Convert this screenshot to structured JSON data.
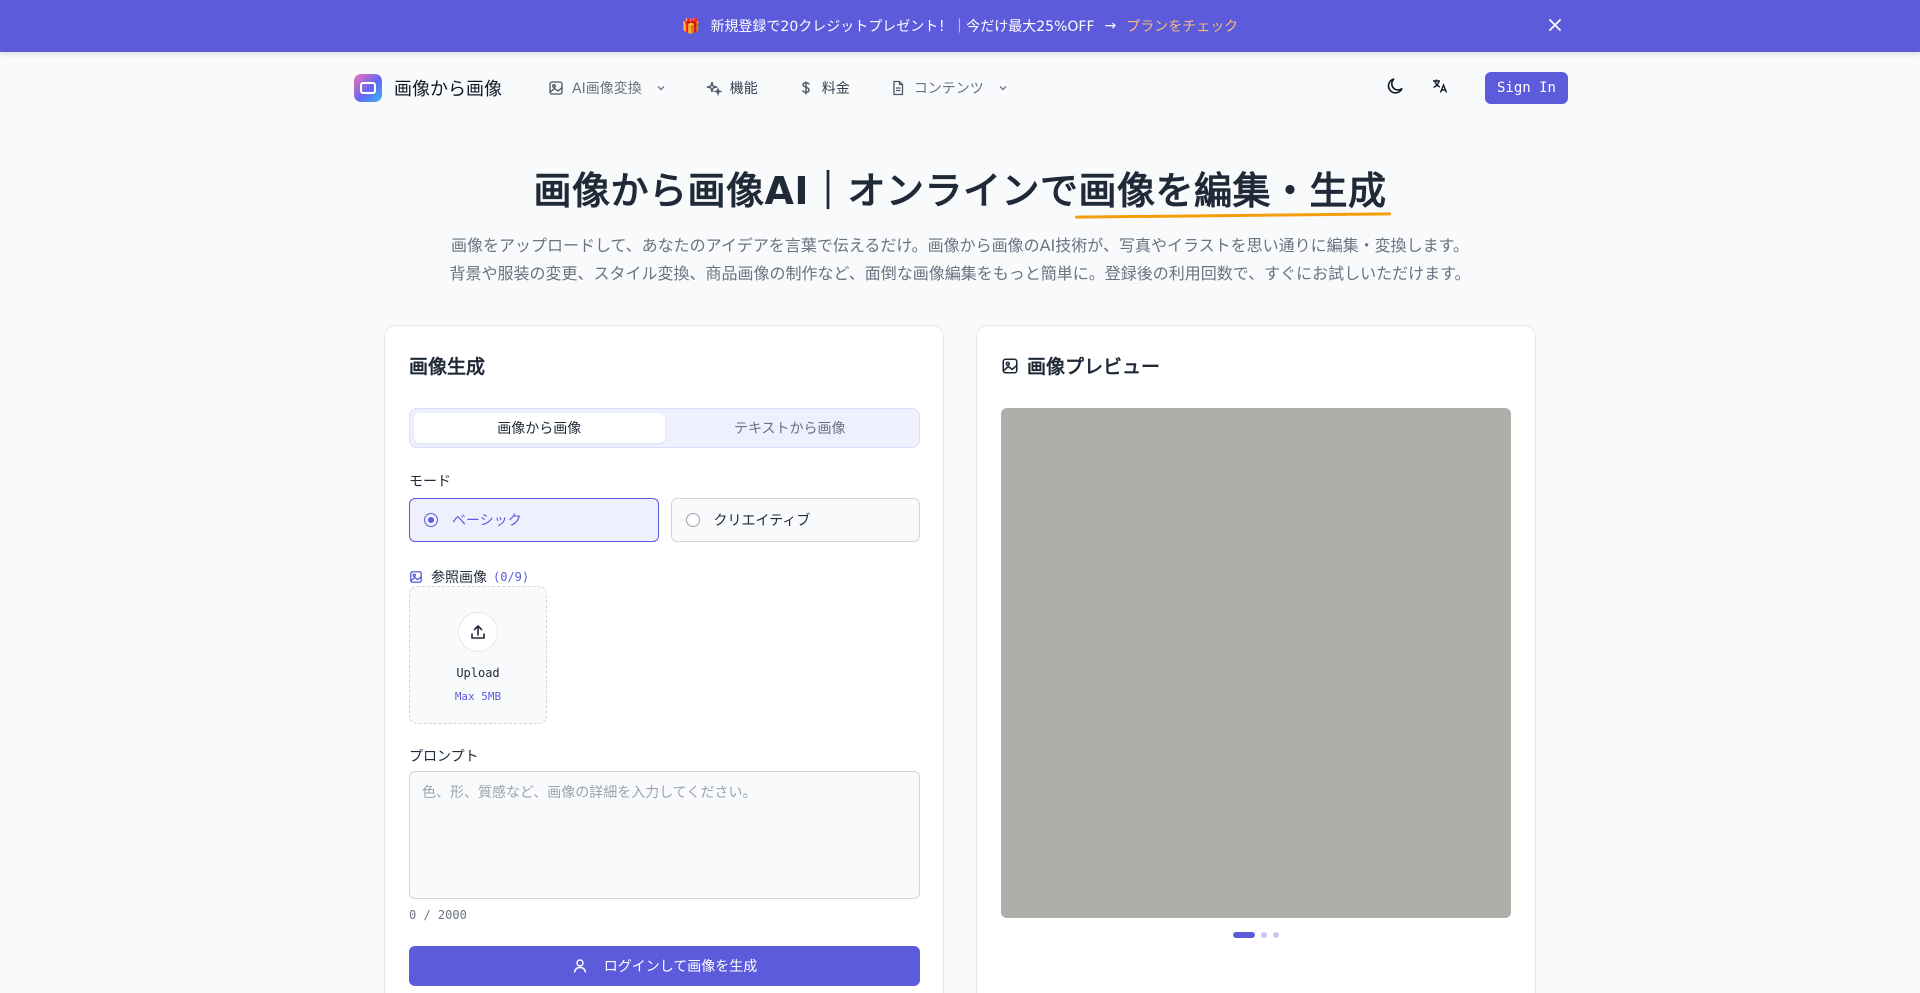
{
  "banner": {
    "gift_icon": "🎁",
    "text": "新規登録で20クレジットプレゼント！｜今だけ最大25%OFF",
    "arrow": "→",
    "link": "プランをチェック",
    "close_icon": "close-icon"
  },
  "nav": {
    "brand": "画像から画像",
    "items": [
      {
        "label": "AI画像変換",
        "icon": "image-icon"
      },
      {
        "label": "機能",
        "icon": "sparkles-icon"
      },
      {
        "label": "料金",
        "icon": "dollar-icon"
      },
      {
        "label": "コンテンツ",
        "icon": "document-icon"
      }
    ],
    "signin": "Sign In"
  },
  "hero": {
    "title_plain": "画像から画像AI｜オンラインで",
    "title_highlight": "画像を編集・生成",
    "subtitle_line1": "画像をアップロードして、あなたのアイデアを言葉で伝えるだけ。画像から画像のAI技術が、写真やイラストを思い通りに編集・変換します。",
    "subtitle_line2": "背景や服装の変更、スタイル変換、商品画像の制作など、面倒な画像編集をもっと簡単に。登録後の利用回数で、すぐにお試しいただけます。"
  },
  "generator": {
    "title": "画像生成",
    "tabs": [
      {
        "label": "画像から画像",
        "active": true
      },
      {
        "label": "テキストから画像",
        "active": false
      }
    ],
    "mode_label": "モード",
    "modes": [
      {
        "label": "ベーシック",
        "selected": true
      },
      {
        "label": "クリエイティブ",
        "selected": false
      }
    ],
    "ref_label": "参照画像",
    "ref_count": "(0/9)",
    "upload_label": "Upload",
    "upload_limit": "Max 5MB",
    "prompt_label": "プロンプト",
    "prompt_placeholder": "色、形、質感など、画像の詳細を入力してください。",
    "prompt_value": "",
    "counter": "0 / 2000",
    "button": "ログインして画像を生成"
  },
  "preview": {
    "title": "画像プレビュー",
    "placeholder_color": "#b0aea9",
    "slides": 3,
    "active_slide": 0
  },
  "colors": {
    "accent": "#5b5bdc",
    "banner_link": "#fdba74",
    "highlight_underline": "#f59e0b"
  }
}
